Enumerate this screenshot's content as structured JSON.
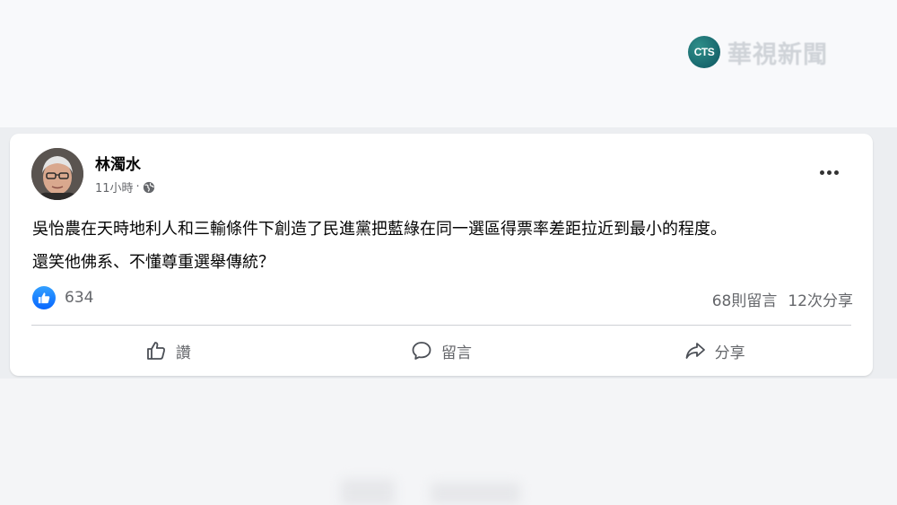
{
  "watermark": {
    "logo_text": "CTS",
    "name": "華視新聞"
  },
  "post": {
    "author": "林濁水",
    "time": "11小時",
    "separator": "·",
    "privacy_icon": "globe-icon",
    "text_line1": "吳怡農在天時地利人和三輸條件下創造了民進黨把藍綠在同一選區得票率差距拉近到最小的程度。",
    "text_line2": "還笑他佛系、不懂尊重選舉傳統？",
    "like_count": "634",
    "comments": "68則留言",
    "shares": "12次分享"
  },
  "actions": {
    "like_label": "讚",
    "comment_label": "留言",
    "share_label": "分享"
  },
  "colors": {
    "like_blue": "#0866ff",
    "secondary_text": "#65676b",
    "card_bg": "#ffffff"
  }
}
